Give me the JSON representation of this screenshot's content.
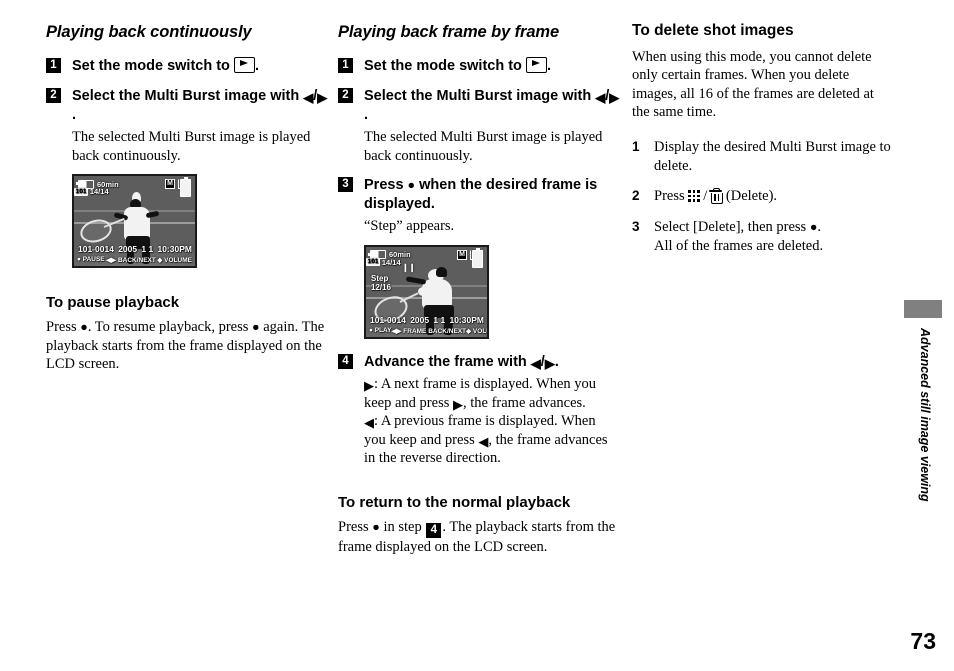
{
  "page": {
    "number": "73",
    "side_tab_label": "Advanced still image viewing"
  },
  "icons": {
    "mode_switch_play": "play-mode-icon",
    "left_arrow": "◀",
    "right_arrow": "▶",
    "control_dot": "●",
    "slash": "/",
    "index_icon": "index-icon",
    "trash_icon": "trash-icon"
  },
  "column1": {
    "title": "Playing back continuously",
    "steps": [
      {
        "num": "1",
        "head_prefix": "Set the mode switch to ",
        "head_suffix": ".",
        "body": ""
      },
      {
        "num": "2",
        "head_prefix": "Select the Multi Burst image with ",
        "head_suffix": ".",
        "body": "The selected Multi Burst image is played back continuously."
      }
    ],
    "lcd": {
      "battery_time": "60min",
      "mode_badge": "M",
      "folder_badge": "1/1",
      "counter_prefix": "101",
      "counter": "14/14",
      "file_no": "101-0014",
      "date": "2005",
      "date2": "1 1",
      "time": "10:30PM",
      "guide_left": "● PAUSE",
      "guide_mid": "◀▶ BACK/NEXT",
      "guide_right": "◆ VOLUME"
    },
    "pause_section": {
      "title": "To pause playback",
      "text_1": "Press ",
      "text_2": ". To resume playback, press ",
      "text_3": " again. The playback starts from the frame displayed on the LCD screen."
    }
  },
  "column2": {
    "title": "Playing back frame by frame",
    "steps": [
      {
        "num": "1",
        "head_prefix": "Set the mode switch to ",
        "head_suffix": ".",
        "body": ""
      },
      {
        "num": "2",
        "head_prefix": "Select the Multi Burst image with ",
        "head_suffix": ".",
        "body": "The selected Multi Burst image is played back continuously."
      },
      {
        "num": "3",
        "head_prefix": "Press ",
        "head_mid": " when the desired frame is displayed.",
        "body": "“Step” appears."
      }
    ],
    "lcd": {
      "battery_time": "60min",
      "mode_badge": "M",
      "folder_badge": "1/1",
      "counter_prefix": "101",
      "counter": "14/14",
      "step_label": "Step",
      "step_value": "12/16",
      "file_no": "101-0014",
      "date": "2005",
      "date2": "1 1",
      "time": "10:30PM",
      "guide_left": "● PLAY",
      "guide_mid": "◀▶ FRAME BACK/NEXT",
      "guide_right": "◆ VOLUME"
    },
    "step4": {
      "num": "4",
      "head_prefix": "Advance the frame with ",
      "head_suffix": ".",
      "body_a_1": ": A next frame is displayed. When you keep and press ",
      "body_a_2": ", the frame advances.",
      "body_b_1": ": A previous frame is displayed. When you keep and press ",
      "body_b_2": ", the frame advances in the reverse direction."
    },
    "return_section": {
      "title": "To return to the normal playback",
      "text_1": "Press ",
      "text_2": " in step ",
      "step_ref": "4",
      "text_3": ". The playback starts from the frame displayed on the LCD screen."
    }
  },
  "column3": {
    "title": "To delete shot images",
    "intro": "When using this mode, you cannot delete only certain frames. When you delete images, all 16 of the frames are deleted at the same time.",
    "steps": [
      {
        "num": "1",
        "text": "Display the desired Multi Burst image to delete."
      },
      {
        "num": "2",
        "text_1": "Press ",
        "text_2": " (Delete)."
      },
      {
        "num": "3",
        "text_1": "Select [Delete], then press ",
        "text_2": ".",
        "text_3": "All of the frames are deleted."
      }
    ]
  },
  "colors": {
    "ink": "#000000",
    "paper": "#ffffff",
    "tab_gray": "#808080",
    "lcd_gray": "#6d6d6d"
  }
}
